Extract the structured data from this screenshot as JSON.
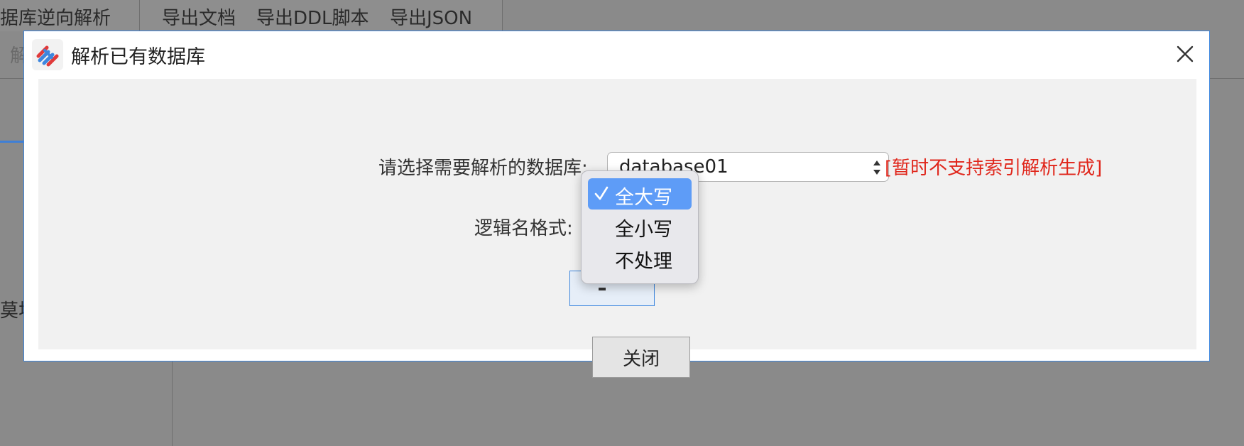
{
  "background": {
    "toolbar_items": [
      "据库逆向解析",
      "导出文档",
      "导出DDL脚本",
      "导出JSON"
    ],
    "faded_char": "解",
    "side_text": "莫块"
  },
  "dialog": {
    "title": "解析已有数据库",
    "close_icon": "close-icon",
    "db_label": "请选择需要解析的数据库:",
    "db_value": "database01",
    "warning": "[暂时不支持索引解析生成]",
    "name_format_label": "逻辑名格式:",
    "close_button": "关闭"
  },
  "popup": {
    "options": [
      "全大写",
      "全小写",
      "不处理"
    ],
    "selected": "全大写"
  },
  "colors": {
    "accent": "#3d86de",
    "warning": "#e0261b",
    "selected_option": "#5e9cf7"
  }
}
